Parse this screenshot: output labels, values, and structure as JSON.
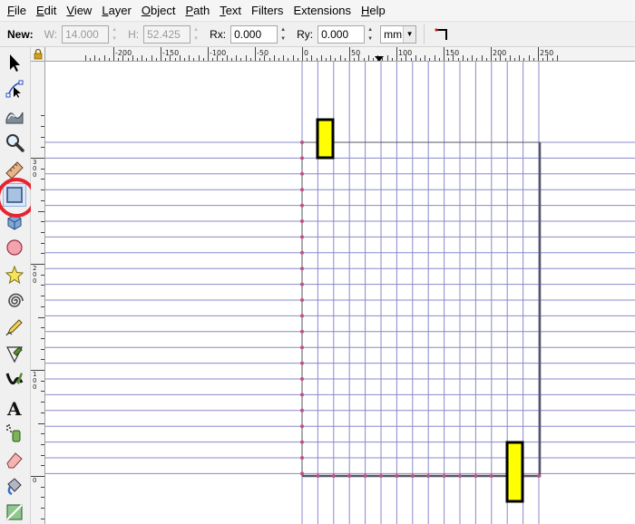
{
  "menu": [
    {
      "mnemonic": "F",
      "rest": "ile"
    },
    {
      "mnemonic": "E",
      "rest": "dit"
    },
    {
      "mnemonic": "V",
      "rest": "iew"
    },
    {
      "mnemonic": "L",
      "rest": "ayer"
    },
    {
      "mnemonic": "O",
      "rest": "bject"
    },
    {
      "mnemonic": "P",
      "rest": "ath"
    },
    {
      "mnemonic": "T",
      "rest": "ext"
    },
    {
      "mnemonic": "",
      "rest": "Filters"
    },
    {
      "mnemonic": "",
      "rest": "Extensions"
    },
    {
      "mnemonic": "H",
      "rest": "elp"
    }
  ],
  "toolctrl": {
    "new_label": "New:",
    "w_label": "W:",
    "w_value": "14.000",
    "h_label": "H:",
    "h_value": "52.425",
    "rx_label": "Rx:",
    "rx_value": "0.000",
    "ry_label": "Ry:",
    "ry_value": "0.000",
    "unit": "mm"
  },
  "tools": [
    "selector-arrow-icon",
    "node-edit-icon",
    "tweak-icon",
    "zoom-icon",
    "measure-icon",
    "rectangle-icon",
    "3d-box-icon",
    "ellipse-icon",
    "star-icon",
    "spiral-icon",
    "pencil-icon",
    "pen-icon",
    "calligraphy-icon",
    "text-icon",
    "spray-icon",
    "eraser-icon",
    "paint-bucket-icon",
    "gradient-icon"
  ],
  "active_tool": "rectangle-icon",
  "hruler_labels": [
    "-200",
    "-150",
    "-100",
    "-50",
    "0",
    "50",
    "100",
    "150",
    "200",
    "250"
  ],
  "vruler_labels": [
    "300",
    "200",
    "100",
    "0"
  ],
  "colors": {
    "grid": "#8888cc",
    "rect_fill": "#ffff00",
    "rect_stroke": "#000000",
    "page_border": "#555566",
    "handle": "#c05080",
    "highlight": "#e8232e"
  }
}
